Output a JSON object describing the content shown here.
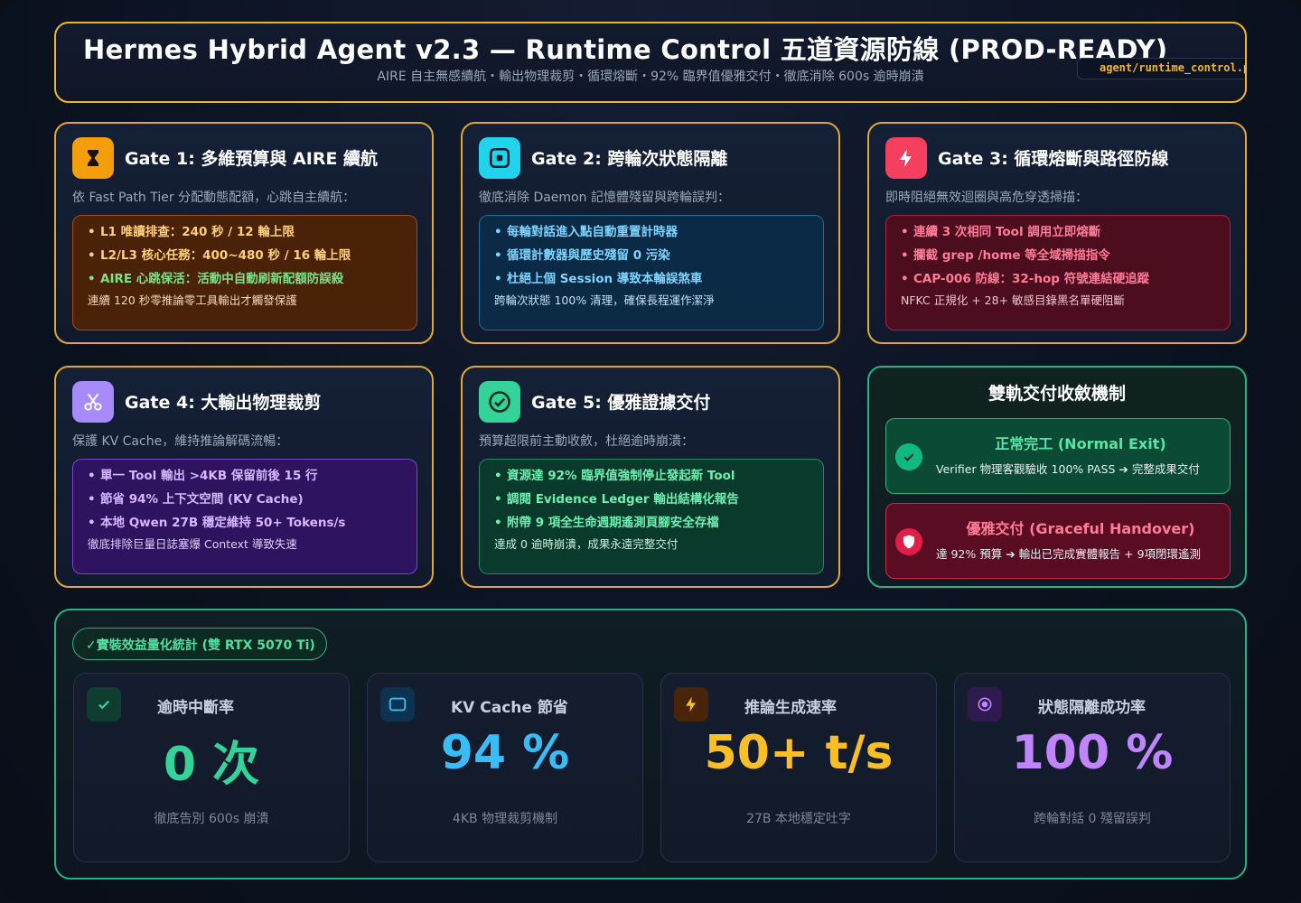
{
  "header": {
    "title": "Hermes Hybrid Agent v2.3 — Runtime Control 五道資源防線 (PROD-READY)",
    "subtitle": "AIRE 自主無感續航・輸出物理裁剪・循環熔斷・92% 臨界值優雅交付・徹底消除 600s 逾時崩潰",
    "file_tag": "agent/runtime_control.py"
  },
  "gates": [
    {
      "icon": "hourglass-icon",
      "title": "Gate 1: 多維預算與 AIRE 續航",
      "desc": "依 Fast Path Tier 分配動態配額，心跳自主續航：",
      "bullets": [
        "L1 唯讀排查：240 秒 / 12 輪上限",
        "L2/L3 核心任務：400~480 秒 / 16 輪上限",
        "AIRE 心跳保活：活動中自動刷新配額防誤殺"
      ],
      "note": "連續 120 秒零推論零工具輸出才觸發保護"
    },
    {
      "icon": "isolation-icon",
      "title": "Gate 2: 跨輪次狀態隔離",
      "desc": "徹底消除 Daemon 記憶體殘留與跨輪誤判：",
      "bullets": [
        "每輪對話進入點自動重置計時器",
        "循環計數器與歷史殘留 0 污染",
        "杜絕上個 Session 導致本輪誤煞車"
      ],
      "note": "跨輪次狀態 100% 清理，確保長程運作潔淨"
    },
    {
      "icon": "lightning-icon",
      "title": "Gate 3: 循環熔斷與路徑防線",
      "desc": "即時阻絕無效迴圈與高危穿透掃描：",
      "bullets": [
        "連續 3 次相同 Tool 調用立即熔斷",
        "攔截 grep /home 等全域掃描指令",
        "CAP-006 防線：32-hop 符號連結硬追蹤"
      ],
      "note": "NFKC 正規化 + 28+ 敏感目錄黑名單硬阻斷"
    },
    {
      "icon": "scissors-icon",
      "title": "Gate 4: 大輸出物理裁剪",
      "desc": "保護 KV Cache，維持推論解碼流暢：",
      "bullets": [
        "單一 Tool 輸出 >4KB 保留前後 15 行",
        "節省 94% 上下文空間 (KV Cache)",
        "本地 Qwen 27B 穩定維持 50+ Tokens/s"
      ],
      "note": "徹底排除巨量日誌塞爆 Context 導致失速"
    },
    {
      "icon": "check-circle-icon",
      "title": "Gate 5: 優雅證據交付",
      "desc": "預算超限前主動收斂，杜絕逾時崩潰：",
      "bullets": [
        "資源達 92% 臨界值強制停止發起新 Tool",
        "調閱 Evidence Ledger 輸出結構化報告",
        "附帶 9 項全生命週期遙測頁腳安全存檔"
      ],
      "note": "達成 0 逾時崩潰，成果永遠完整交付"
    }
  ],
  "convergence": {
    "title": "雙軌交付收斂機制",
    "normal": {
      "icon": "check-icon",
      "title": "正常完工 (Normal Exit)",
      "desc": "Verifier 物理客觀驗收 100% PASS ➔ 完整成果交付"
    },
    "handover": {
      "icon": "shield-icon",
      "title": "優雅交付 (Graceful Handover)",
      "desc": "達 92% 預算 ➔ 輸出已完成實體報告 + 9項閉環遙測"
    }
  },
  "stats": {
    "badge": "實裝效益量化統計 (雙 RTX 5070 Ti)",
    "items": [
      {
        "icon": "check-icon",
        "label": "逾時中斷率",
        "value": "0 次",
        "sub": "徹底告別 600s 崩潰",
        "color": "#34d399"
      },
      {
        "icon": "window-icon",
        "label": "KV Cache 節省",
        "value": "94 %",
        "sub": "4KB 物理裁剪機制",
        "color": "#38bdf8"
      },
      {
        "icon": "lightning-icon",
        "label": "推論生成速率",
        "value": "50+ t/s",
        "sub": "27B 本地穩定吐字",
        "color": "#fbbf24"
      },
      {
        "icon": "target-icon",
        "label": "狀態隔離成功率",
        "value": "100 %",
        "sub": "跨輪對話 0 殘留誤判",
        "color": "#c084fc"
      }
    ]
  }
}
